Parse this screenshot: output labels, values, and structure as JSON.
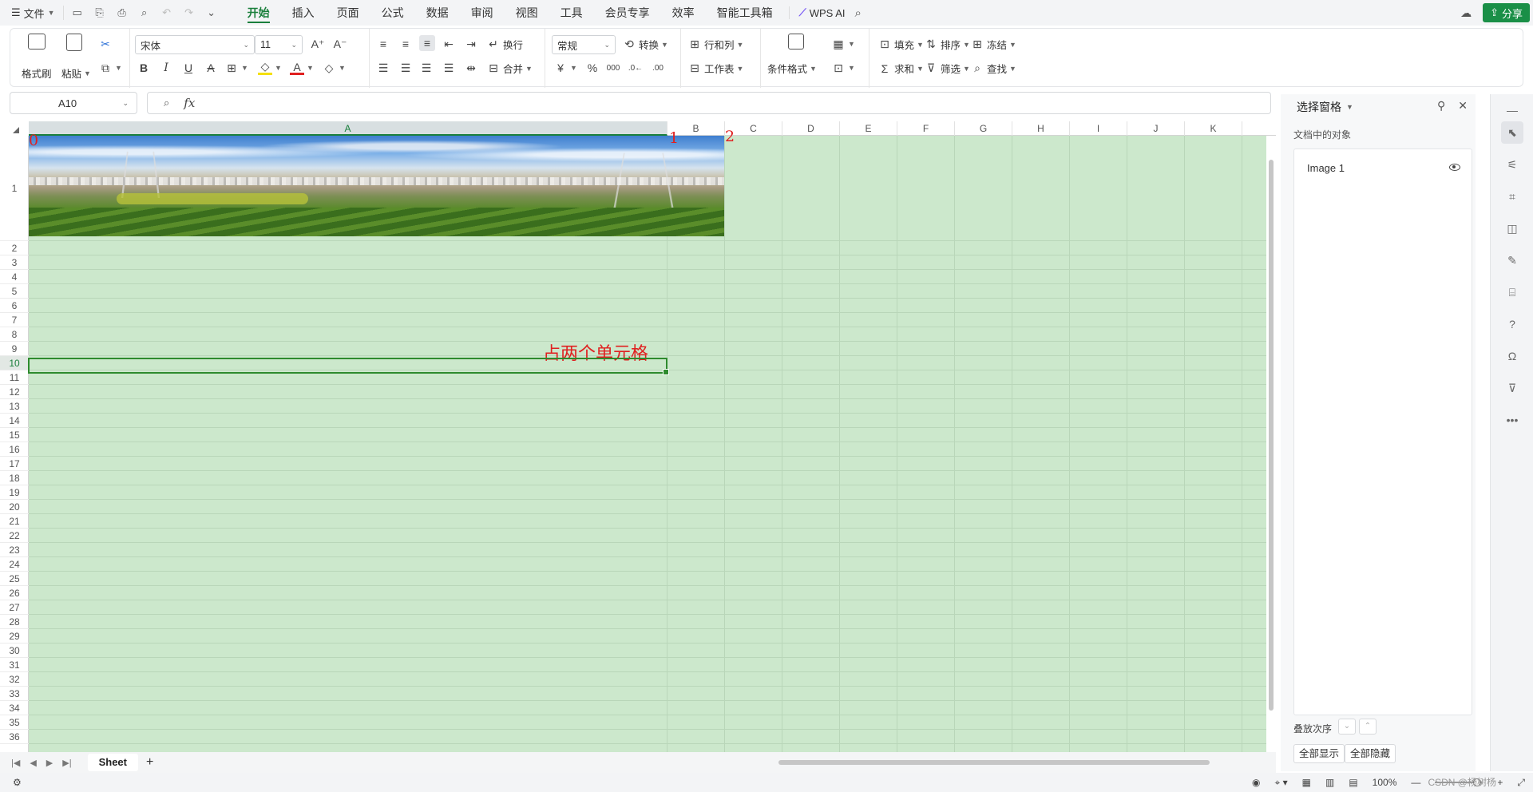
{
  "topbar": {
    "file_label": "文件",
    "tabs": [
      "开始",
      "插入",
      "页面",
      "公式",
      "数据",
      "审阅",
      "视图",
      "工具",
      "会员专享",
      "效率",
      "智能工具箱"
    ],
    "active_tab": "开始",
    "wps_ai_label": "WPS AI",
    "share_label": "分享"
  },
  "ribbon": {
    "format_painter": "格式刷",
    "paste": "粘贴",
    "font_name": "宋体",
    "font_size": "11",
    "wrap": "换行",
    "merge": "合并",
    "number_format": "常规",
    "convert": "转换",
    "rows_cols": "行和列",
    "worksheet": "工作表",
    "conditional_format": "条件格式",
    "fill": "填充",
    "sort": "排序",
    "freeze": "冻结",
    "sum": "求和",
    "filter": "筛选",
    "find": "查找"
  },
  "formula_bar": {
    "name_box": "A10",
    "fx_label": "fx",
    "content": ""
  },
  "grid": {
    "columns": [
      "A",
      "B",
      "C",
      "D",
      "E",
      "F",
      "G",
      "H",
      "I",
      "J",
      "K"
    ],
    "selected_column": "A",
    "rows": [
      "1",
      "2",
      "3",
      "4",
      "5",
      "6",
      "7",
      "8",
      "9",
      "10",
      "11",
      "12",
      "13",
      "14",
      "15",
      "16",
      "17",
      "18",
      "19",
      "20",
      "21",
      "22",
      "23",
      "24",
      "25",
      "26",
      "27",
      "28",
      "29",
      "30",
      "31",
      "32",
      "33",
      "34",
      "35",
      "36"
    ],
    "selected_row": "10",
    "markers": [
      "0",
      "1",
      "2"
    ],
    "cell_text": "占两个单元格"
  },
  "sheet_tabs": {
    "sheets": [
      "Sheet"
    ],
    "add_label": "+"
  },
  "statusbar": {
    "zoom": "100%",
    "watermark": "CSDN @杨树杨"
  },
  "selection_pane": {
    "title": "选择窗格",
    "subtitle": "文档中的对象",
    "objects": [
      "Image 1"
    ],
    "order_label": "叠放次序",
    "show_all": "全部显示",
    "hide_all": "全部隐藏"
  }
}
